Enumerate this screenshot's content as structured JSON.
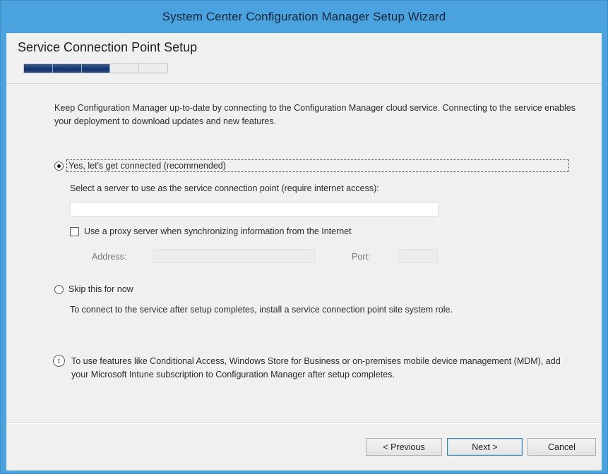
{
  "window": {
    "title": "System Center Configuration Manager Setup Wizard"
  },
  "header": {
    "page_title": "Service Connection Point Setup",
    "progress_steps_total": 5,
    "progress_steps_completed": 3
  },
  "intro_text": "Keep Configuration Manager up-to-date by connecting to the Configuration Manager cloud service. Connecting to the service enables your deployment to download updates and new features.",
  "connect_option": {
    "label": "Yes, let's get connected (recommended)",
    "selected": true,
    "server_prompt": "Select a server to use as the service connection point (require internet access):",
    "server_value": "",
    "proxy_checkbox_label": "Use a proxy server when synchronizing information from the Internet",
    "proxy_checked": false,
    "address_label": "Address:",
    "address_value": "",
    "port_label": "Port:",
    "port_value": ""
  },
  "skip_option": {
    "label": "Skip this for now",
    "selected": false,
    "description": "To connect to the service after setup completes, install a service connection point site system role."
  },
  "info_note": "To use features like Conditional Access, Windows Store for Business or on-premises mobile device management (MDM), add your Microsoft Intune subscription to Configuration Manager after setup completes.",
  "footer": {
    "previous_label": "< Previous",
    "next_label": "Next >",
    "cancel_label": "Cancel"
  },
  "colors": {
    "title_bar": "#4aa3df",
    "progress_fill": "#1f3f7a",
    "client_background": "#f0f0f0"
  }
}
